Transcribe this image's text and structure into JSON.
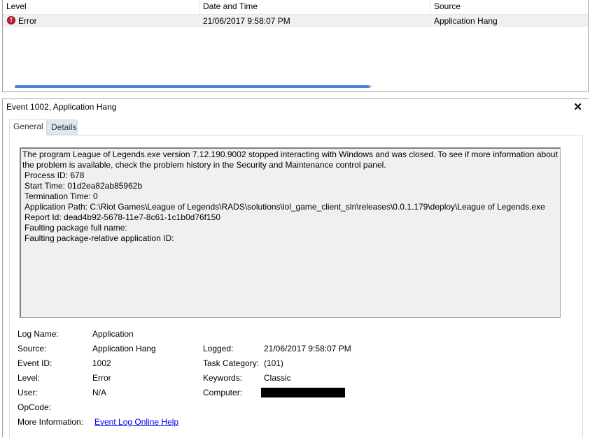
{
  "event_list": {
    "columns": [
      "Level",
      "Date and Time",
      "Source"
    ],
    "row": {
      "level": "Error",
      "date_time": "21/06/2017 9:58:07 PM",
      "source": "Application Hang"
    }
  },
  "detail": {
    "title": "Event 1002, Application Hang",
    "tabs": [
      "General",
      "Details"
    ],
    "description_lines": [
      "The program League of Legends.exe version 7.12.190.9002 stopped interacting with Windows and was closed. To see if more information about",
      "the problem is available, check the problem history in the Security and Maintenance control panel.",
      "Process ID: 678",
      "Start Time: 01d2ea82ab85962b",
      "Termination Time: 0",
      "Application Path: C:\\Riot Games\\League of Legends\\RADS\\solutions\\lol_game_client_sln\\releases\\0.0.1.179\\deploy\\League of Legends.exe",
      "Report Id: dead4b92-5678-11e7-8c61-1c1b0d76f150",
      "Faulting package full name:",
      "Faulting package-relative application ID:"
    ],
    "properties": {
      "log_name_label": "Log Name:",
      "log_name": "Application",
      "source_label": "Source:",
      "source": "Application Hang",
      "logged_label": "Logged:",
      "logged": "21/06/2017 9:58:07 PM",
      "event_id_label": "Event ID:",
      "event_id": "1002",
      "task_category_label": "Task Category:",
      "task_category": "(101)",
      "level_label": "Level:",
      "level": "Error",
      "keywords_label": "Keywords:",
      "keywords": "Classic",
      "user_label": "User:",
      "user": "N/A",
      "computer_label": "Computer:",
      "opcode_label": "OpCode:",
      "more_info_label": "More Information:",
      "more_info_link": "Event Log Online Help"
    }
  },
  "colors": {
    "error_icon": "#c3213c",
    "link": "#0000ee",
    "scroll_thumb": "#3f85d4"
  },
  "icons": {
    "error": "error-icon",
    "close": "close-icon"
  }
}
